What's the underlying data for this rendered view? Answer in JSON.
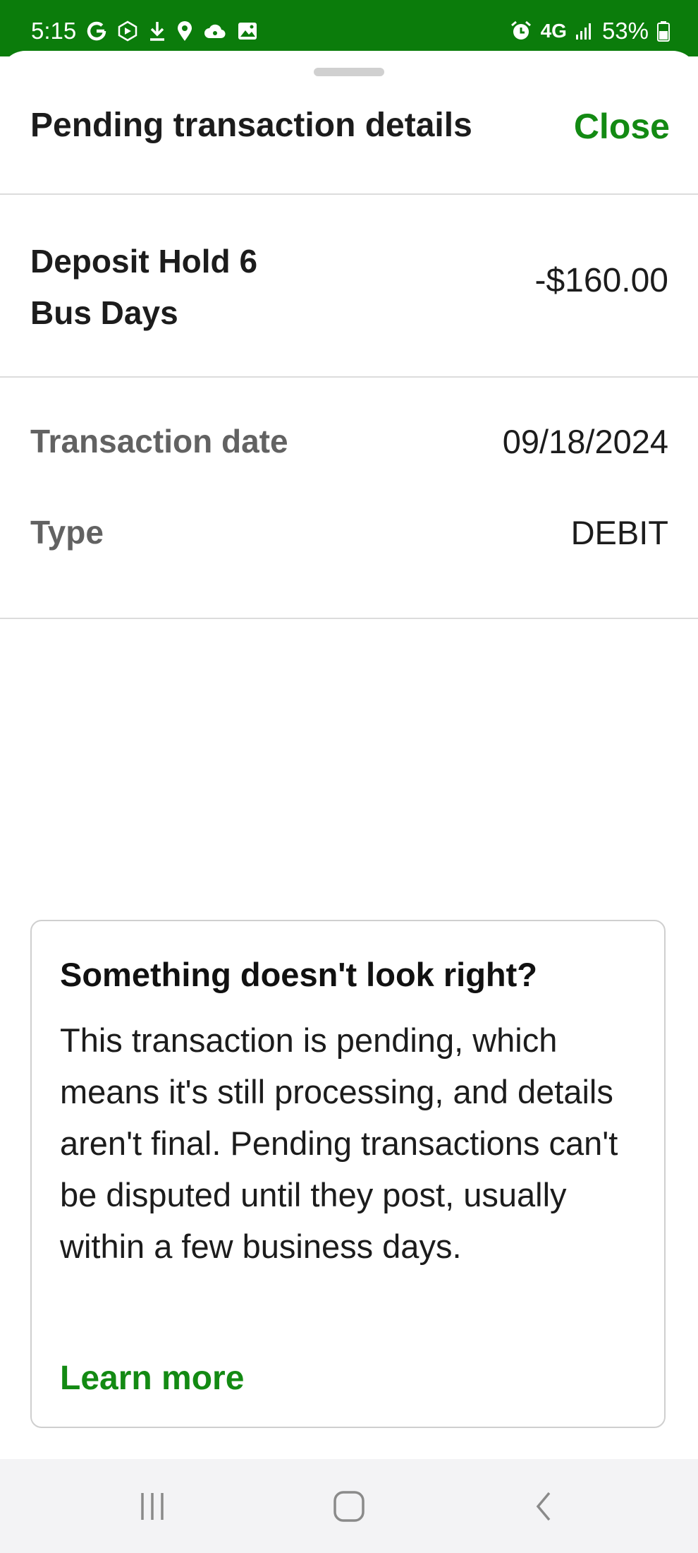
{
  "status_bar": {
    "time": "5:15",
    "network": "4G",
    "battery": "53%",
    "left_icons": [
      "google-icon",
      "sync-icon",
      "download-icon",
      "location-icon",
      "cloud-icon",
      "image-icon"
    ],
    "right_icons": [
      "alarm-icon",
      "signal-icon",
      "battery-icon"
    ]
  },
  "header": {
    "title": "Pending transaction details",
    "close_label": "Close"
  },
  "transaction": {
    "description_line1": "Deposit Hold 6",
    "description_line2": "Bus Days",
    "amount": "-$160.00"
  },
  "details": [
    {
      "label": "Transaction date",
      "value": "09/18/2024"
    },
    {
      "label": "Type",
      "value": "DEBIT"
    }
  ],
  "info_card": {
    "title": "Something doesn't look right?",
    "body": "This transaction is pending, which means it's still processing, and details aren't final. Pending transactions can't be disputed until they post, usually within a few business days.",
    "link_label": "Learn more"
  },
  "nav_bar": {
    "icons": [
      "recent-apps-icon",
      "home-icon",
      "back-icon"
    ]
  },
  "colors": {
    "status_bar": "#0b7c0b",
    "accent_green": "#138a13",
    "label_gray": "#626262",
    "divider": "#dcdcdc"
  }
}
